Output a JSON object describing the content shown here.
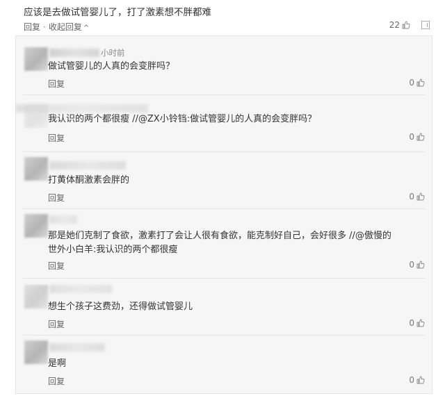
{
  "top_comment": {
    "text": "应该是去做试管婴儿了，打了激素想不胖都难",
    "actions": {
      "reply": "回复",
      "collapse": "收起回复"
    },
    "likes": "22"
  },
  "replies": [
    {
      "time": "小时前",
      "text": "做试管婴儿的人真的会变胖吗？",
      "reply_label": "回复",
      "likes": "0"
    },
    {
      "time": "",
      "text": "我认识的两个都很瘦 //@ZX小铃铛:做试管婴儿的人真的会变胖吗？",
      "reply_label": "回复",
      "likes": "0"
    },
    {
      "time": "",
      "text": "打黄体酮激素会胖的",
      "reply_label": "回复",
      "likes": "0"
    },
    {
      "time": "",
      "text": "那是她们克制了食欲，激素打了会让人很有食欲，能克制好自己，会好很多 //@傲慢的",
      "text2": "世外小白羊:我认识的两个都很瘦",
      "reply_label": "回复",
      "likes": "0"
    },
    {
      "time": "",
      "text": "想生个孩子这费劲，还得做试管婴儿",
      "reply_label": "回复",
      "likes": "0"
    },
    {
      "time": "",
      "text": "是啊",
      "reply_label": "回复",
      "likes": "0"
    }
  ],
  "icons": {
    "like": "thumbs-up-icon",
    "chevron": "chevron-up-icon",
    "more": "box-icon"
  }
}
